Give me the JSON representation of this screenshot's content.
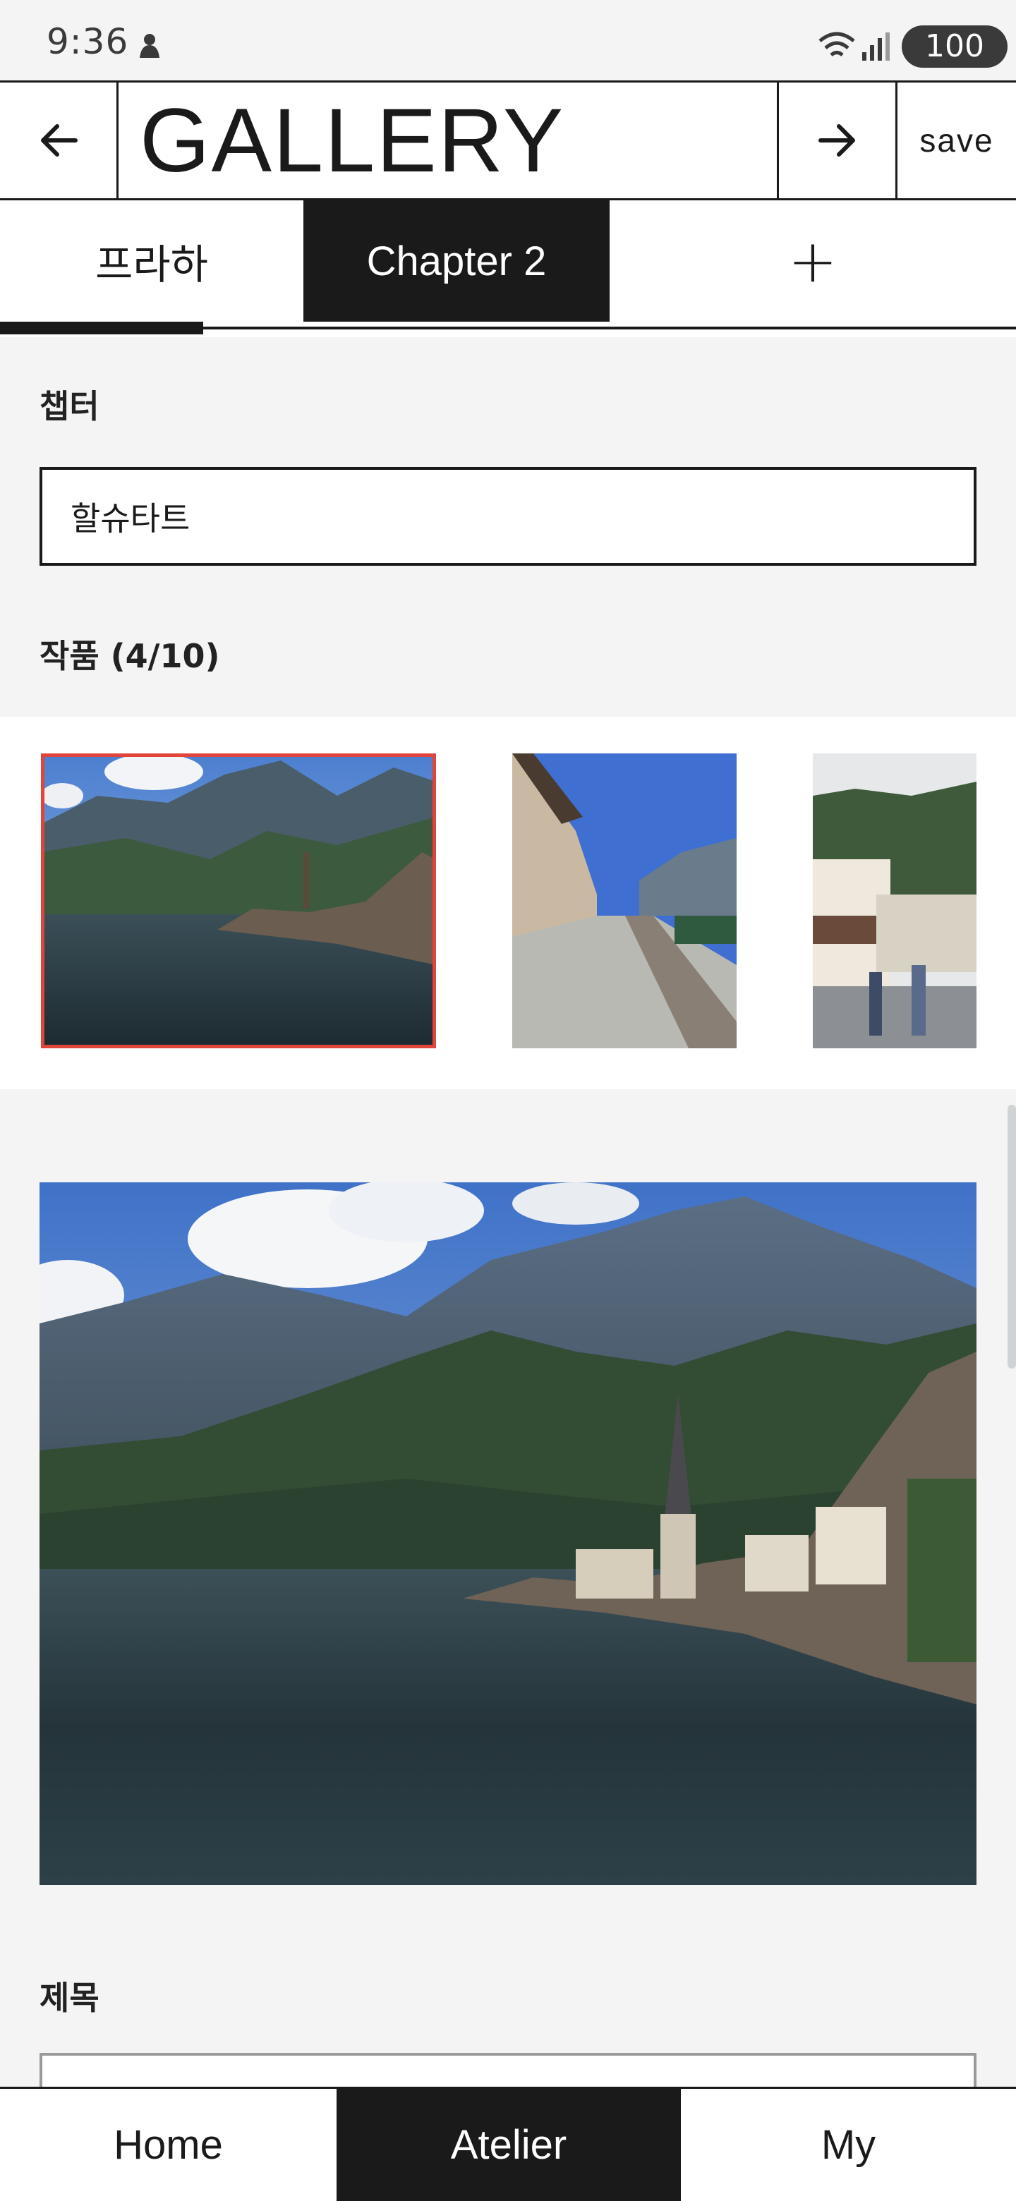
{
  "status_bar": {
    "time": "9:36",
    "battery": "100",
    "icons": [
      "notification-icon",
      "wifi-icon",
      "signal-icon"
    ]
  },
  "header": {
    "back_icon": "arrow-left-icon",
    "title": "GALLERY",
    "next_icon": "arrow-right-icon",
    "save_label": "save"
  },
  "tabs": {
    "items": [
      {
        "label": "프라하",
        "active": false
      },
      {
        "label": "Chapter 2",
        "active": true
      }
    ],
    "add_label": "+",
    "progress": 0.2
  },
  "chapter": {
    "label": "챕터",
    "value": "할슈타트"
  },
  "works": {
    "label": "작품 (4/10)",
    "selected_index": 0,
    "thumbnails": [
      "hallstatt-lake-photo",
      "hallstatt-street-photo",
      "hallstatt-square-photo"
    ]
  },
  "preview": {
    "image": "hallstatt-lake-photo"
  },
  "title_field": {
    "label": "제목",
    "value": ""
  },
  "bottom_nav": {
    "items": [
      {
        "label": "Home",
        "active": false
      },
      {
        "label": "Atelier",
        "active": true
      },
      {
        "label": "My",
        "active": false
      }
    ]
  },
  "colors": {
    "primary": "#1a1a1a",
    "selection": "#e0443a",
    "background": "#f4f4f4"
  }
}
